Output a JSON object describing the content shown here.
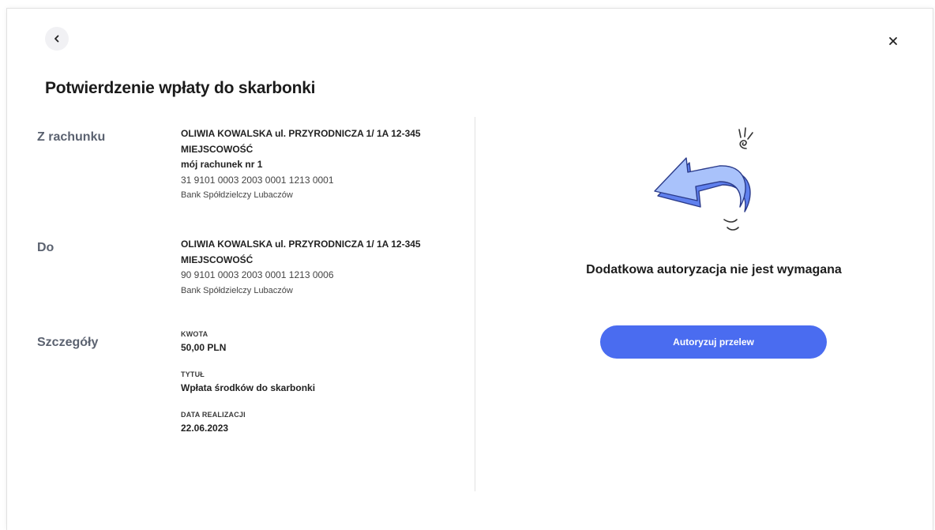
{
  "header": {
    "title": "Potwierdzenie wpłaty do skarbonki"
  },
  "from": {
    "label": "Z rachunku",
    "name_line1": "OLIWIA KOWALSKA ul. PRZYRODNICZA 1/ 1A 12-345",
    "name_line2": "MIEJSCOWOŚĆ",
    "account_name": "mój rachunek nr 1",
    "account_number": "31 9101 0003 2003 0001 1213 0001",
    "bank": "Bank Spółdzielczy Lubaczów"
  },
  "to": {
    "label": "Do",
    "name_line1": "OLIWIA KOWALSKA ul. PRZYRODNICZA 1/ 1A 12-345",
    "name_line2": "MIEJSCOWOŚĆ",
    "account_number": "90 9101 0003 2003 0001 1213 0006",
    "bank": "Bank Spółdzielczy Lubaczów"
  },
  "details": {
    "label": "Szczegóły",
    "amount_label": "KWOTA",
    "amount": "50,00 PLN",
    "title_label": "TYTUŁ",
    "title": "Wpłata środków do skarbonki",
    "date_label": "DATA REALIZACJI",
    "date": "22.06.2023"
  },
  "authorization": {
    "status": "Dodatkowa autoryzacja nie jest wymagana",
    "button_label": "Autoryzuj przelew"
  },
  "icons": {
    "back": "chevron-left-icon",
    "close": "close-icon",
    "illustration": "return-arrow-illustration"
  },
  "colors": {
    "accent": "#4a6cf0",
    "arrow_fill": "#a9c2fb",
    "arrow_side": "#5f80ee",
    "label_gray": "#5b6270"
  }
}
